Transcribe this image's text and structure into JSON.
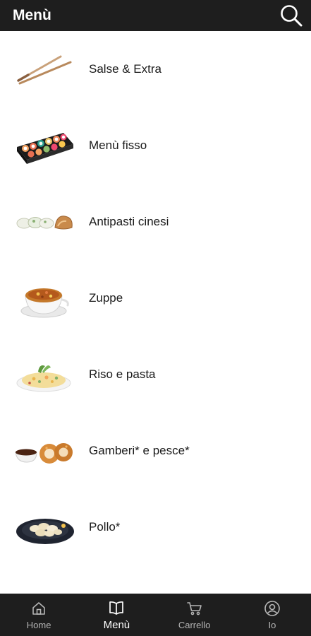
{
  "header": {
    "title": "Menù",
    "search_icon": "search-icon"
  },
  "menu": {
    "items": [
      {
        "label": "Salse & Extra",
        "icon": "chopsticks-icon"
      },
      {
        "label": "Menù fisso",
        "icon": "sushi-tray-icon"
      },
      {
        "label": "Antipasti cinesi",
        "icon": "dumplings-icon"
      },
      {
        "label": "Zuppe",
        "icon": "soup-bowl-icon"
      },
      {
        "label": "Riso e pasta",
        "icon": "rice-plate-icon"
      },
      {
        "label": "Gamberi* e pesce*",
        "icon": "fried-shrimp-icon"
      },
      {
        "label": "Pollo*",
        "icon": "chicken-plate-icon"
      }
    ]
  },
  "bottom_nav": {
    "active": "Menù",
    "tabs": [
      {
        "label": "Home",
        "icon": "home-icon"
      },
      {
        "label": "Menù",
        "icon": "book-icon"
      },
      {
        "label": "Carrello",
        "icon": "cart-icon"
      },
      {
        "label": "Io",
        "icon": "user-icon"
      }
    ]
  },
  "colors": {
    "bar_background": "#1e1e1e",
    "text_primary": "#1a1a1a",
    "tab_inactive": "#b5b5b5",
    "tab_active": "#ffffff"
  }
}
